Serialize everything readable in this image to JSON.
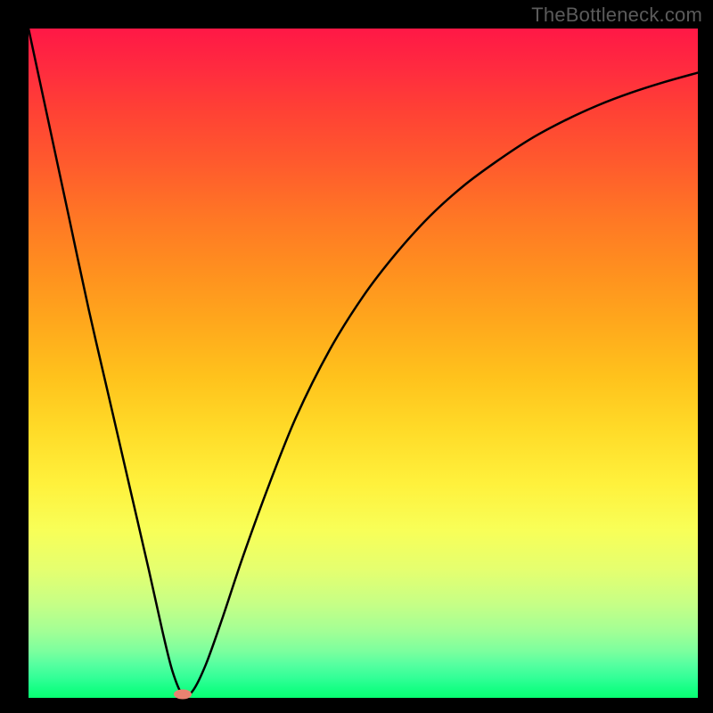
{
  "watermark": "TheBottleneck.com",
  "chart_data": {
    "type": "line",
    "title": "",
    "xlabel": "",
    "ylabel": "",
    "xlim": [
      0,
      100
    ],
    "ylim": [
      0,
      100
    ],
    "grid": false,
    "background": "gradient-red-to-green",
    "series": [
      {
        "name": "bottleneck-curve",
        "x": [
          0,
          3,
          6,
          9,
          12,
          15,
          18,
          20,
          21.5,
          23,
          24.5,
          26.5,
          29,
          32,
          36,
          40,
          45,
          50,
          55,
          60,
          65,
          70,
          75,
          80,
          85,
          90,
          95,
          100
        ],
        "values": [
          100,
          86,
          72,
          58,
          45,
          32,
          19,
          10,
          4,
          0.5,
          1,
          5,
          12,
          21,
          32,
          42,
          52,
          60,
          66.5,
          72,
          76.5,
          80.2,
          83.5,
          86.2,
          88.5,
          90.4,
          92,
          93.4
        ]
      }
    ],
    "minimum_point": {
      "x": 23,
      "y": 0.5
    }
  }
}
